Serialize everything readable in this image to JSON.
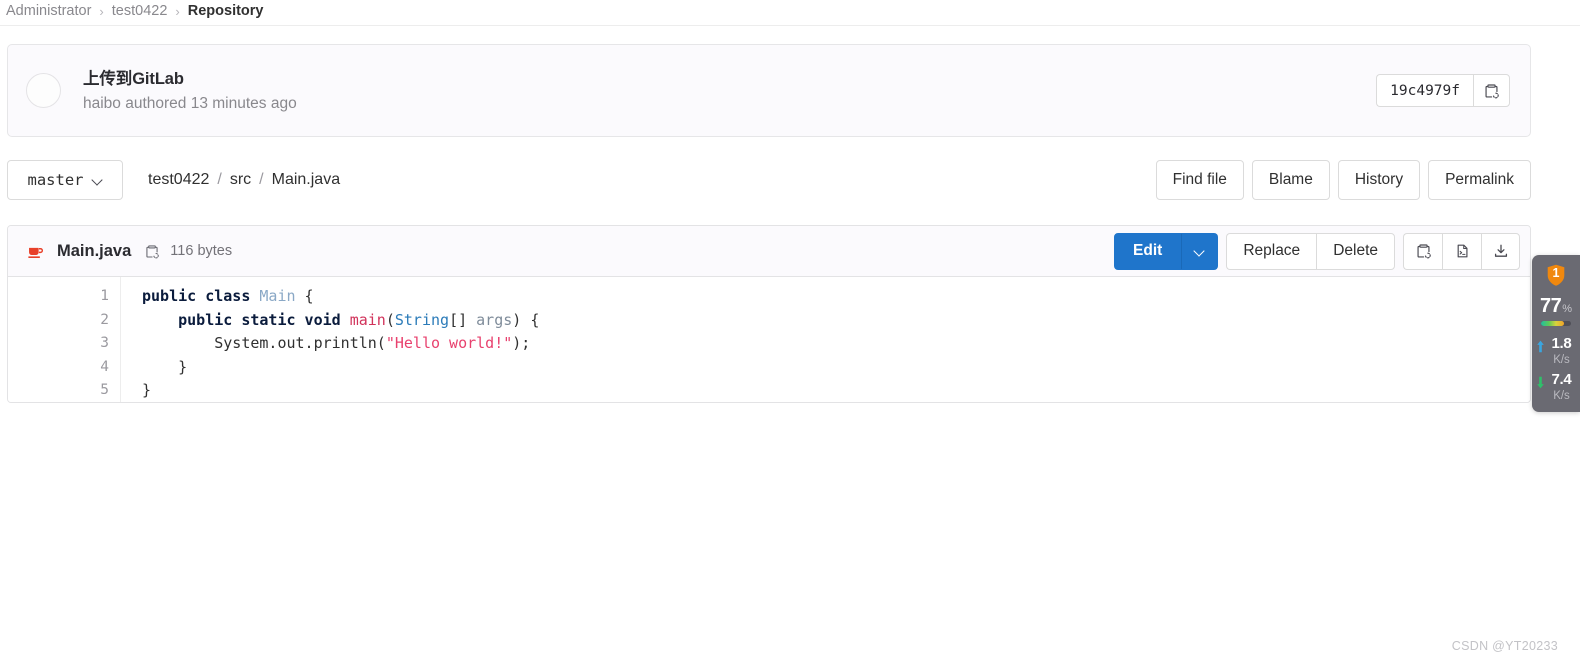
{
  "breadcrumb": {
    "items": [
      "Administrator",
      "test0422"
    ],
    "current": "Repository",
    "separator": "›"
  },
  "commit": {
    "title": "上传到GitLab",
    "author_line": "haibo authored 13 minutes ago",
    "sha": "19c4979f",
    "copy_icon": "copy-to-clipboard-icon",
    "avatar": "user-avatar"
  },
  "path_row": {
    "branch": "master",
    "branch_caret": "chevron-down-icon",
    "crumbs": [
      "test0422",
      "src",
      "Main.java"
    ],
    "separator": "/",
    "actions": [
      "Find file",
      "Blame",
      "History",
      "Permalink"
    ]
  },
  "file": {
    "icon": "java-coffee-cup-icon",
    "name": "Main.java",
    "copy_icon": "copy-file-path-icon",
    "size": "116 bytes",
    "edit_label": "Edit",
    "edit_caret": "chevron-down-icon",
    "replace_label": "Replace",
    "delete_label": "Delete",
    "icon_buttons": [
      "copy-contents-icon",
      "open-raw-icon",
      "download-icon"
    ]
  },
  "code": {
    "line_numbers": [
      "1",
      "2",
      "3",
      "4",
      "5"
    ],
    "lines": [
      [
        {
          "t": "public class ",
          "c": "k"
        },
        {
          "t": "Main",
          "c": "t"
        },
        {
          "t": " {",
          "c": "pl"
        }
      ],
      [
        {
          "t": "    public static void ",
          "c": "k"
        },
        {
          "t": "main",
          "c": "fn"
        },
        {
          "t": "(",
          "c": "pl"
        },
        {
          "t": "String",
          "c": "ty"
        },
        {
          "t": "[] ",
          "c": "pl"
        },
        {
          "t": "args",
          "c": "pm"
        },
        {
          "t": ") {",
          "c": "pl"
        }
      ],
      [
        {
          "t": "        System.out.println(",
          "c": "pl"
        },
        {
          "t": "\"Hello world!\"",
          "c": "st"
        },
        {
          "t": ");",
          "c": "pl"
        }
      ],
      [
        {
          "t": "    }",
          "c": "pl"
        }
      ],
      [
        {
          "t": "}",
          "c": "pl"
        }
      ]
    ]
  },
  "net_widget": {
    "shield_badge": "1",
    "percent_value": "77",
    "percent_symbol": "%",
    "percent_fill": 77,
    "upload_value": "1.8",
    "upload_unit": "K/s",
    "download_value": "7.4",
    "download_unit": "K/s"
  },
  "watermark": "CSDN @YT20233",
  "colors": {
    "accent_blue": "#1f75cb",
    "java_red": "#e8402a",
    "shield_orange": "#f0880e",
    "string_pink": "#e8416e",
    "widget_gray": "#6a6a72"
  }
}
